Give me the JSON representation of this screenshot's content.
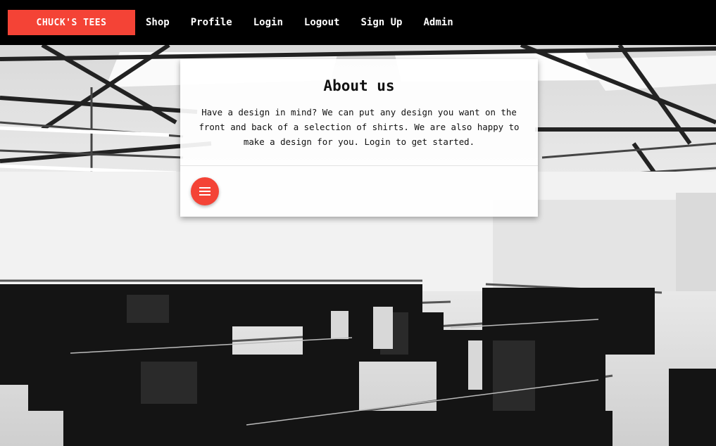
{
  "navbar": {
    "brand": "CHUCK'S TEES",
    "links": [
      "Shop",
      "Profile",
      "Login",
      "Logout",
      "Sign Up",
      "Admin"
    ]
  },
  "about_card": {
    "title": "About us",
    "text": "Have a design in mind? We can put any design you want on the front and back of a selection of shirts. We are also happy to make a design for you. Login to get started.",
    "menu_icon": "menu-icon"
  },
  "colors": {
    "accent": "#f44336",
    "navbar": "#000000"
  }
}
